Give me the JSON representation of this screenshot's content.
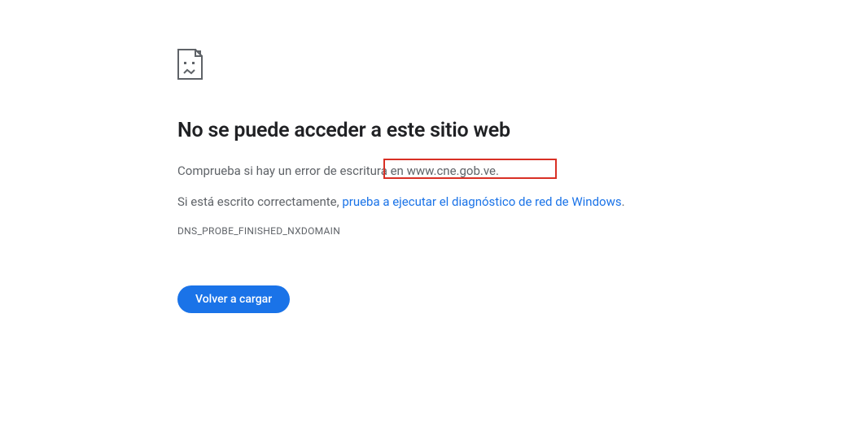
{
  "error": {
    "title": "No se puede acceder a este sitio web",
    "line1_prefix": "Comprueba si hay un error de escritura en ",
    "line1_domain": "www.cne.gob.ve",
    "line1_suffix": ".",
    "line2_prefix": "Si está escrito correctamente, ",
    "line2_link": "prueba a ejecutar el diagnóstico de red de Windows",
    "line2_suffix": ".",
    "error_code": "DNS_PROBE_FINISHED_NXDOMAIN",
    "reload_label": "Volver a cargar"
  },
  "colors": {
    "text_primary": "#202124",
    "text_secondary": "#5f6368",
    "link": "#1a73e8",
    "button_bg": "#1a73e8",
    "highlight_border": "#d93025"
  }
}
